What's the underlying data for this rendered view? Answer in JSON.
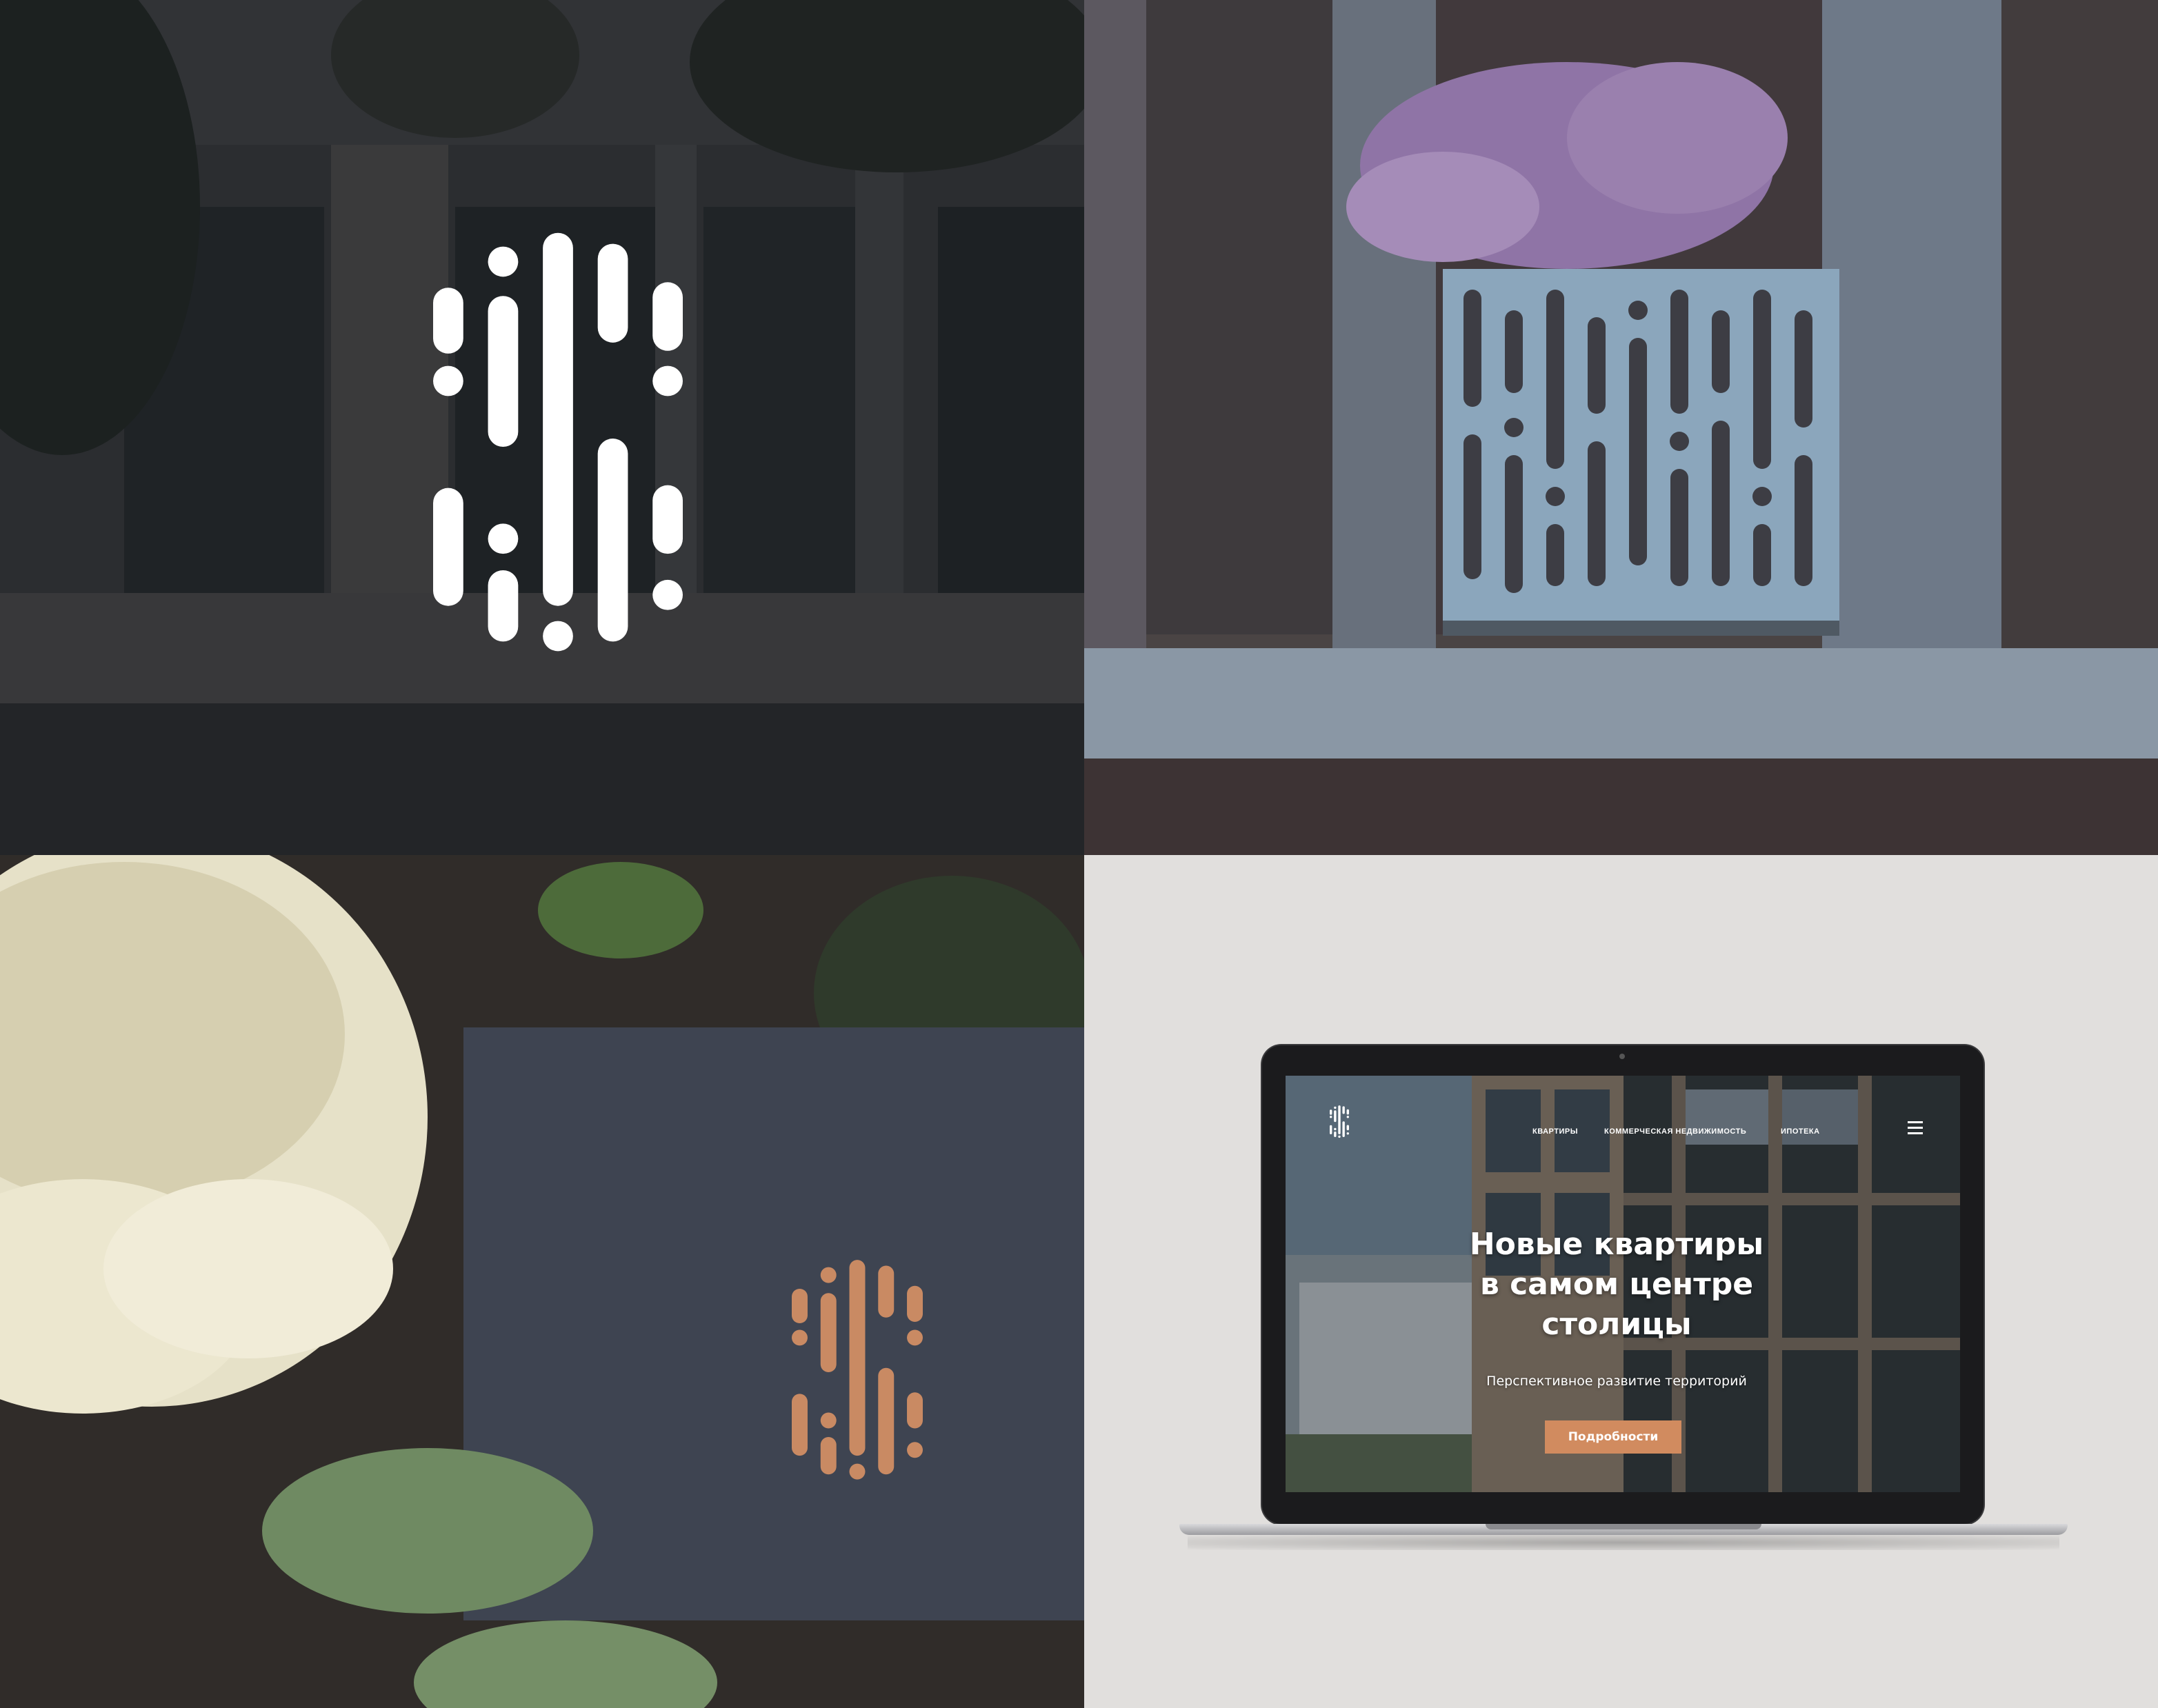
{
  "palette": {
    "logo_white": "#ffffff",
    "logo_copper": "#c98a63",
    "card_slate": "#3e4451",
    "balcony_blue": "#8ba6bc",
    "cta_orange": "#d18b5f",
    "backdrop_gray": "#e1dfdd"
  },
  "panels": [
    {
      "id": "building-logo",
      "description_icon": "logo-mark-icon"
    },
    {
      "id": "balcony-photo",
      "description_icon": "balcony-grille-icon"
    },
    {
      "id": "business-card",
      "description_icon": "copper-logo-icon"
    },
    {
      "id": "laptop-website",
      "description_icon": "laptop-icon"
    }
  ],
  "website": {
    "nav": {
      "items": [
        "КВАРТИРЫ",
        "КОММЕРЧЕСКАЯ НЕДВИЖИМОСТЬ",
        "ИПОТЕКА"
      ],
      "menu_icon": "hamburger-menu-icon"
    },
    "headline_lines": [
      "Новые квартиры",
      "в самом центре",
      "столицы"
    ],
    "subtitle": "Перспективное развитие территорий",
    "cta_label": "Подробности"
  }
}
